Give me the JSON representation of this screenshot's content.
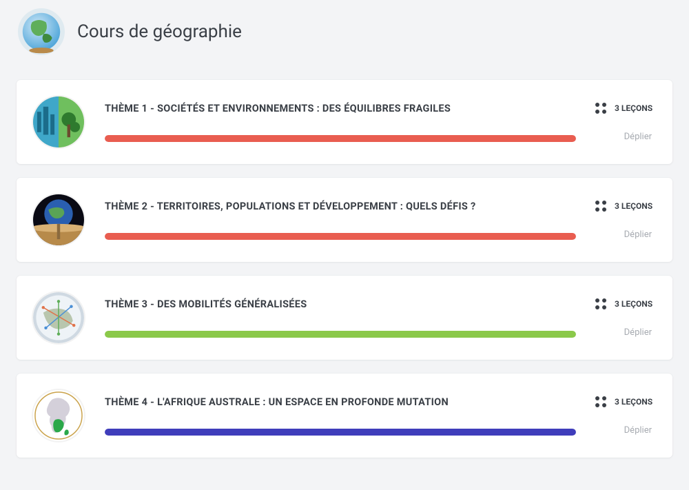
{
  "page_title": "Cours de géographie",
  "colors": {
    "red": "#e95d50",
    "green": "#8bc94a",
    "indigo": "#3f3dbb"
  },
  "themes": [
    {
      "title": "THÈME 1 - SOCIÉTÉS ET ENVIRONNEMENTS : DES ÉQUILIBRES FRAGILES",
      "lessons": "3 LEÇONS",
      "expand": "Déplier",
      "progress": 100,
      "bar_color": "red",
      "thumb": "city-nature"
    },
    {
      "title": "THÈME 2 - TERRITOIRES, POPULATIONS ET DÉVELOPPEMENT : QUELS DÉFIS ?",
      "lessons": "3 LEÇONS",
      "expand": "Déplier",
      "progress": 100,
      "bar_color": "red",
      "thumb": "planet-horizon"
    },
    {
      "title": "THÈME 3 - DES MOBILITÉS GÉNÉRALISÉES",
      "lessons": "3 LEÇONS",
      "expand": "Déplier",
      "progress": 100,
      "bar_color": "green",
      "thumb": "world-network"
    },
    {
      "title": "THÈME 4 - L'AFRIQUE AUSTRALE : UN ESPACE EN PROFONDE MUTATION",
      "lessons": "3 LEÇONS",
      "expand": "Déplier",
      "progress": 100,
      "bar_color": "indigo",
      "thumb": "africa"
    }
  ]
}
